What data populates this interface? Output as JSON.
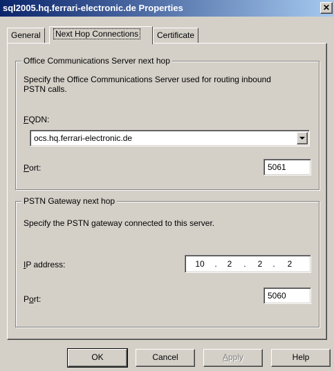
{
  "window": {
    "title": "sql2005.hq.ferrari-electronic.de Properties",
    "close_glyph": "✕"
  },
  "tabs": [
    {
      "label": "General"
    },
    {
      "label": "Next Hop Connections"
    },
    {
      "label": "Certificate"
    }
  ],
  "active_tab": "Next Hop Connections",
  "ocs_group": {
    "title": "Office Communications Server next hop",
    "description_line1": "Specify the Office Communications Server used for routing inbound",
    "description_line2": "PSTN calls.",
    "fqdn_label_mnemonic": "F",
    "fqdn_label_rest": "QDN:",
    "fqdn_value": "ocs.hq.ferrari-electronic.de",
    "port_label_mnemonic": "P",
    "port_label_rest": "ort:",
    "port_value": "5061"
  },
  "pstn_group": {
    "title": "PSTN Gateway next hop",
    "description": "Specify the PSTN gateway connected to this server.",
    "ip_label_mnemonic": "I",
    "ip_label_rest": "P address:",
    "ip_octets": [
      "10",
      "2",
      "2",
      "2"
    ],
    "ip_separator": ".",
    "port_label_pre": "P",
    "port_label_mnemonic": "o",
    "port_label_rest": "rt:",
    "port_value": "5060"
  },
  "buttons": {
    "ok": "OK",
    "cancel": "Cancel",
    "apply_mnemonic": "A",
    "apply_rest": "pply",
    "help": "Help"
  },
  "colors": {
    "titlebar_start": "#0a246a",
    "titlebar_end": "#a6caf0",
    "dialog_face": "#d4d0c8"
  }
}
